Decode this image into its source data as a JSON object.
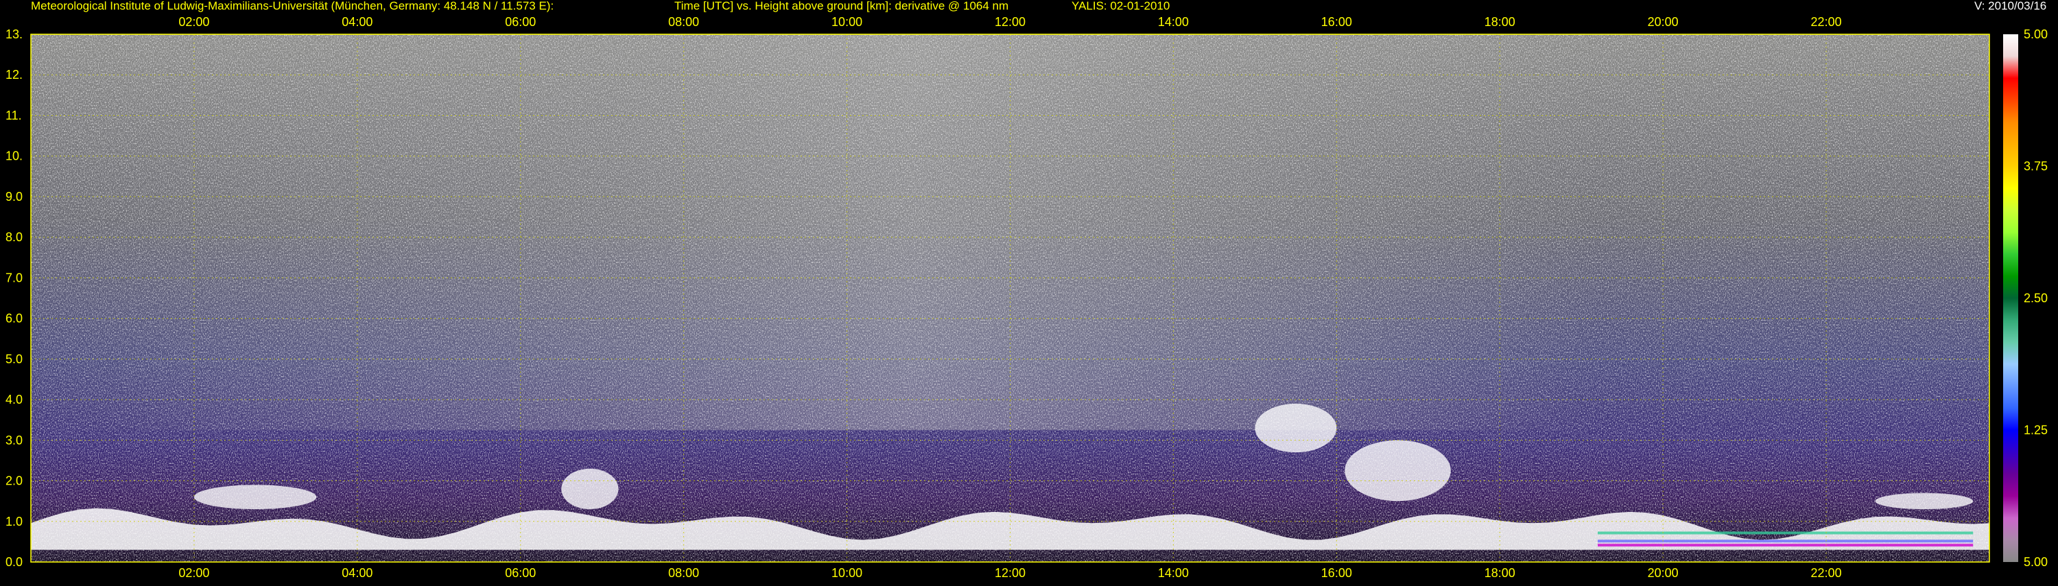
{
  "header": {
    "institute": "Meteorological Institute of Ludwig-Maximilians-Universität (München, Germany: 48.148 N / 11.573 E):",
    "plot_title": "Time [UTC] vs. Height above ground [km]: derivative @ 1064 nm",
    "instrument": "YALIS: 02-01-2010",
    "version": "V: 2010/03/16"
  },
  "colors": {
    "background": "#000000",
    "text": "#ffff00",
    "grid": "#cccc00",
    "frame": "#ffff00"
  },
  "chart_data": {
    "type": "heatmap",
    "title": "Time [UTC] vs. Height above ground [km]: derivative @ 1064 nm",
    "xlabel": "Time [UTC]",
    "ylabel": "Height above ground [km]",
    "xlim": [
      0,
      24
    ],
    "ylim": [
      0,
      13
    ],
    "x_ticks": [
      "02:00",
      "04:00",
      "06:00",
      "08:00",
      "10:00",
      "12:00",
      "14:00",
      "16:00",
      "18:00",
      "20:00",
      "22:00"
    ],
    "x_tick_values": [
      2,
      4,
      6,
      8,
      10,
      12,
      14,
      16,
      18,
      20,
      22
    ],
    "y_ticks": [
      "0.0",
      "1.0",
      "2.0",
      "3.0",
      "4.0",
      "5.0",
      "6.0",
      "7.0",
      "8.0",
      "9.0",
      "10.",
      "11.",
      "12.",
      "13."
    ],
    "y_tick_values": [
      0,
      1,
      2,
      3,
      4,
      5,
      6,
      7,
      8,
      9,
      10,
      11,
      12,
      13
    ],
    "grid": true,
    "colorbar": {
      "labels": [
        "5.00",
        "3.75",
        "2.50",
        "1.25",
        "5.00"
      ],
      "positions": [
        1.0,
        0.75,
        0.5,
        0.25,
        0.0
      ],
      "colors_top_to_bottom": [
        "#ffffff",
        "#f0d8d8",
        "#ff0000",
        "#ff4500",
        "#ff8c00",
        "#ffb000",
        "#ffd000",
        "#ffff00",
        "#ccff33",
        "#99ff33",
        "#33cc33",
        "#009900",
        "#006633",
        "#33aa77",
        "#66ccaa",
        "#99ccff",
        "#6699ff",
        "#3366ff",
        "#0000ff",
        "#3300cc",
        "#660099",
        "#990099",
        "#cc66cc",
        "#aa88aa",
        "#888888"
      ]
    },
    "features": [
      {
        "name": "boundary layer aerosol (white band)",
        "time_start": 0,
        "time_end": 24,
        "height_km": [
          0.3,
          1.5
        ]
      },
      {
        "name": "cloud",
        "time_start": 2.0,
        "time_end": 3.5,
        "height_km": [
          1.3,
          1.9
        ]
      },
      {
        "name": "cloud",
        "time_start": 6.5,
        "time_end": 7.2,
        "height_km": [
          1.3,
          2.3
        ]
      },
      {
        "name": "cloud",
        "time_start": 15.0,
        "time_end": 16.0,
        "height_km": [
          2.7,
          3.9
        ]
      },
      {
        "name": "cloud",
        "time_start": 16.1,
        "time_end": 17.4,
        "height_km": [
          1.5,
          3.0
        ]
      },
      {
        "name": "cloud",
        "time_start": 22.6,
        "time_end": 23.8,
        "height_km": [
          1.3,
          1.7
        ]
      }
    ]
  }
}
